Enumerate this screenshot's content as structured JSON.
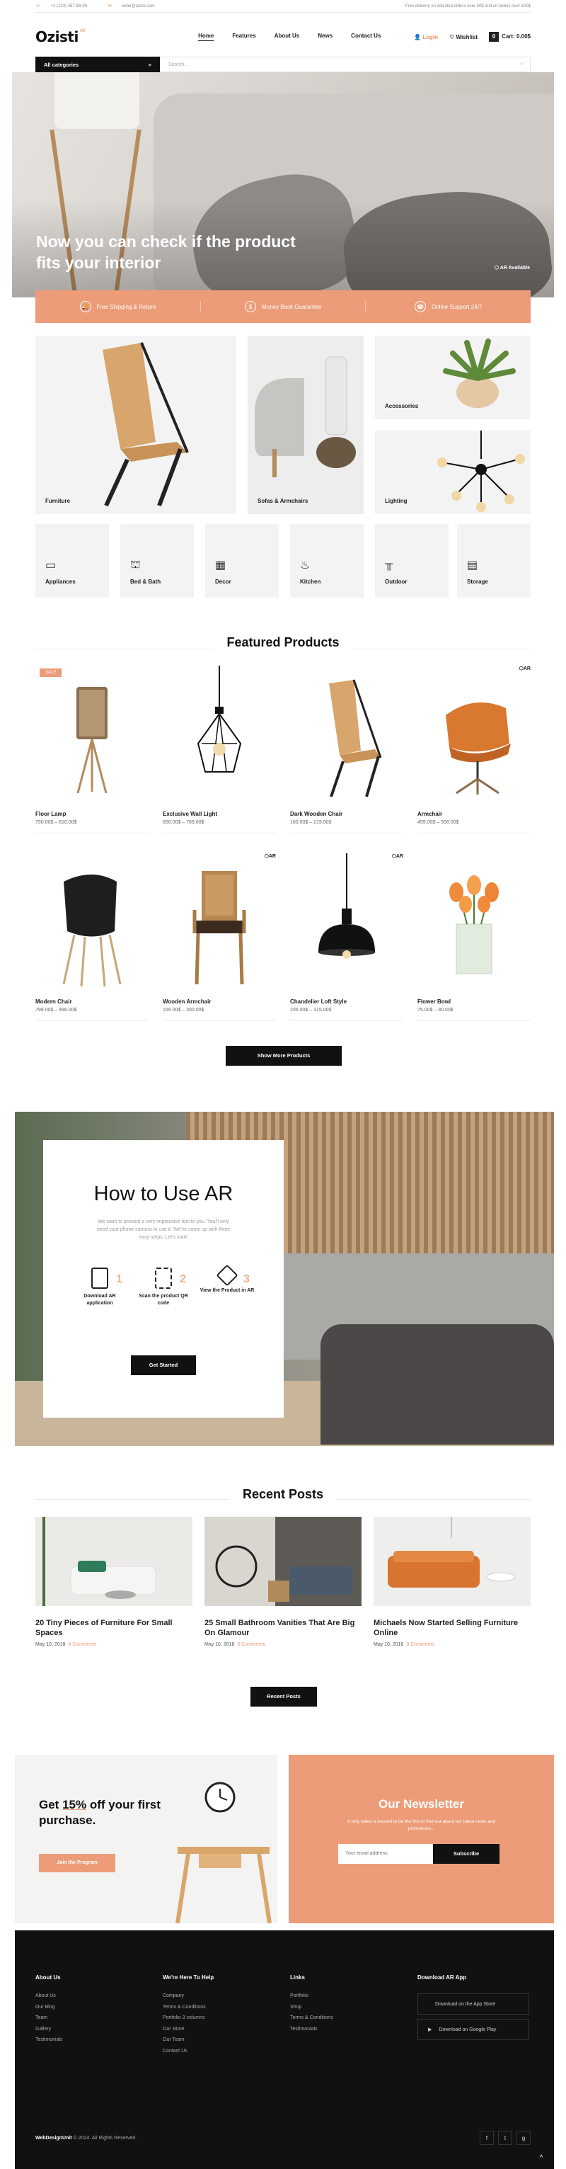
{
  "topbar": {
    "phone": "+1 (123) 457-89-90",
    "email": "order@ozisti.com",
    "delivery": "Free delivery on selected orders over 50$ and all orders over 500$"
  },
  "header": {
    "logo": "Ozisti",
    "logo_sub": "AR",
    "nav": [
      "Home",
      "Features",
      "About Us",
      "News",
      "Contact Us"
    ],
    "login": "Login",
    "wishlist": "Wishlist",
    "cart": "Cart: 0.00$",
    "cart_count": "0"
  },
  "search": {
    "categories": "All categories",
    "placeholder": "Search..."
  },
  "hero": {
    "title": "Now you can check if the product fits your interior",
    "ar_badge": "AR Available"
  },
  "features": [
    {
      "icon": "truck-icon",
      "label": "Free Shipping & Return"
    },
    {
      "icon": "money-icon",
      "label": "Money Back Guarantee"
    },
    {
      "icon": "headset-icon",
      "label": "Online Support 24/7"
    }
  ],
  "categories_large": [
    "Furniture",
    "Sofas & Armchairs",
    "Accessories",
    "Lighting"
  ],
  "categories_small": [
    {
      "label": "Appliances",
      "icon": "appliance-icon"
    },
    {
      "label": "Bed & Bath",
      "icon": "bed-icon"
    },
    {
      "label": "Decor",
      "icon": "decor-icon"
    },
    {
      "label": "Kitchen",
      "icon": "kitchen-icon"
    },
    {
      "label": "Outdoor",
      "icon": "outdoor-icon"
    },
    {
      "label": "Storage",
      "icon": "storage-icon"
    }
  ],
  "featured": {
    "title": "Featured Products",
    "sale_label": "SALE",
    "ar_label": "AR",
    "products": [
      {
        "name": "Floor Lamp",
        "price": "750.00$ – 810.00$"
      },
      {
        "name": "Exclusive Wall Light",
        "price": "650.00$ – 769.00$"
      },
      {
        "name": "Dark Wooden Chair",
        "price": "160.00$ – 219.00$"
      },
      {
        "name": "Armchair",
        "price": "459.00$ – 506.00$"
      },
      {
        "name": "Modern Chair",
        "price": "798.00$ – 498.00$"
      },
      {
        "name": "Wooden Armchair",
        "price": "159.00$ – 300.00$"
      },
      {
        "name": "Chandelier Loft Style",
        "price": "205.00$ – 315.00$"
      },
      {
        "name": "Flower Bowl",
        "price": "75.00$ – 80.00$"
      }
    ],
    "show_more": "Show More Products"
  },
  "ar": {
    "title": "How to Use AR",
    "desc": "We want to present a very impressive tool to you. You'll only need your phone camera to use it. We've come up with three easy steps. Let's start!",
    "steps": [
      {
        "num": "1",
        "label": "Download AR application"
      },
      {
        "num": "2",
        "label": "Scan the product QR code"
      },
      {
        "num": "3",
        "label": "View the Product in AR"
      }
    ],
    "button": "Get Started"
  },
  "blog": {
    "title": "Recent Posts",
    "posts": [
      {
        "title": "20 Tiny Pieces of Furniture For Small Spaces",
        "date": "May 10, 2018",
        "comments": "4 Comments"
      },
      {
        "title": "25 Small Bathroom Vanities That Are Big On Glamour",
        "date": "May 10, 2018",
        "comments": "0 Comments"
      },
      {
        "title": "Michaels Now Started Selling Furniture Online",
        "date": "May 10, 2018",
        "comments": "0 Comments"
      }
    ],
    "button": "Recent Posts"
  },
  "promo": {
    "title_pre": "Get ",
    "title_highlight": "15%",
    "title_post": " off your first purchase.",
    "button": "Join the Program"
  },
  "newsletter": {
    "title": "Our Newsletter",
    "desc": "It only takes a second to be the first to find out about our latest news and promotions...",
    "placeholder": "Your email address",
    "button": "Subscribe"
  },
  "footer": {
    "col1": {
      "title": "About Us",
      "items": [
        "About Us",
        "Our Blog",
        "Team",
        "Gallery",
        "Testimonials"
      ]
    },
    "col2": {
      "title": "We're Here To Help",
      "items": [
        "Company",
        "Terms & Conditions",
        "Portfolio 3 columns",
        "Our Store",
        "Our Team",
        "Contact Us"
      ]
    },
    "col3": {
      "title": "Links",
      "items": [
        "Portfolio",
        "Shop",
        "Terms & Conditions",
        "Testimonials"
      ]
    },
    "col4": {
      "title": "Download AR App",
      "app_store": "Download on the App Store",
      "google_play": "Download on Google Play"
    },
    "copyright_brand": "WebDesignUnit",
    "copyright": " © 2024. All Rights Reserved.",
    "social": [
      "f",
      "t",
      "g"
    ],
    "to_top": "^"
  },
  "colors": {
    "accent": "#ec9c78",
    "dark": "#111111"
  }
}
